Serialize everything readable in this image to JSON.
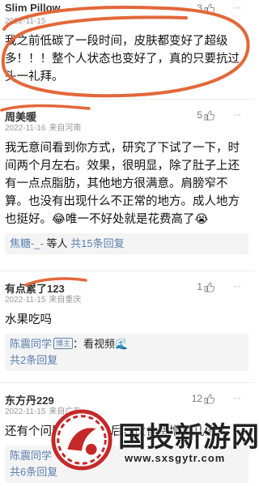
{
  "comments": [
    {
      "name": "Slim Pillow",
      "date": "2022-11-15",
      "location": "",
      "likes": "3",
      "text": "我之前低碳了一段时间，皮肤都变好了超级多！！！整个人状态也变好了，真的只要抗过头一礼拜。"
    },
    {
      "name": "周美暖",
      "date": "2022-11-16",
      "location": "来自河南",
      "likes": "5",
      "text": "我无意间看到你方式，研究了下试了一下，时间两个月左右。效果，很明显，除了肚子上还有一点点脂肪，其他地方很满意。肩膀窄不算。也没有出现什么不正常的地方。成人地方也挺好。😂唯一不好处就是花费高了😭",
      "reply": {
        "name": "焦糖-_-",
        "text": " 等人 ",
        "count": "共15条回复"
      }
    },
    {
      "name": "有点累了123",
      "date": "2022-11-15",
      "location": "来自重庆",
      "likes": "1",
      "text": "水果吃吗",
      "reply": {
        "name": "陈震同学",
        "badge": "博主",
        "text": "：看视频🌊",
        "count": "共2条回复"
      }
    },
    {
      "name": "东方丹229",
      "date": "2022-11-15",
      "location": "来自广东",
      "likes": "12",
      "text": "还有个问题，吃肉肉后，伙食费增加几倍?",
      "reply": {
        "name": "陈震同学",
        "count": "共6条回复"
      }
    }
  ],
  "more_glyph": "···",
  "watermark": {
    "title": "国投新游网",
    "url": "www.sxsgytr.com"
  },
  "colors": {
    "scribble": "#e2683a",
    "link": "#5a7fb0"
  },
  "icons": [
    "thumb-up-icon",
    "more-dots-icon",
    "laugh-emoji-icon",
    "cry-emoji-icon"
  ]
}
